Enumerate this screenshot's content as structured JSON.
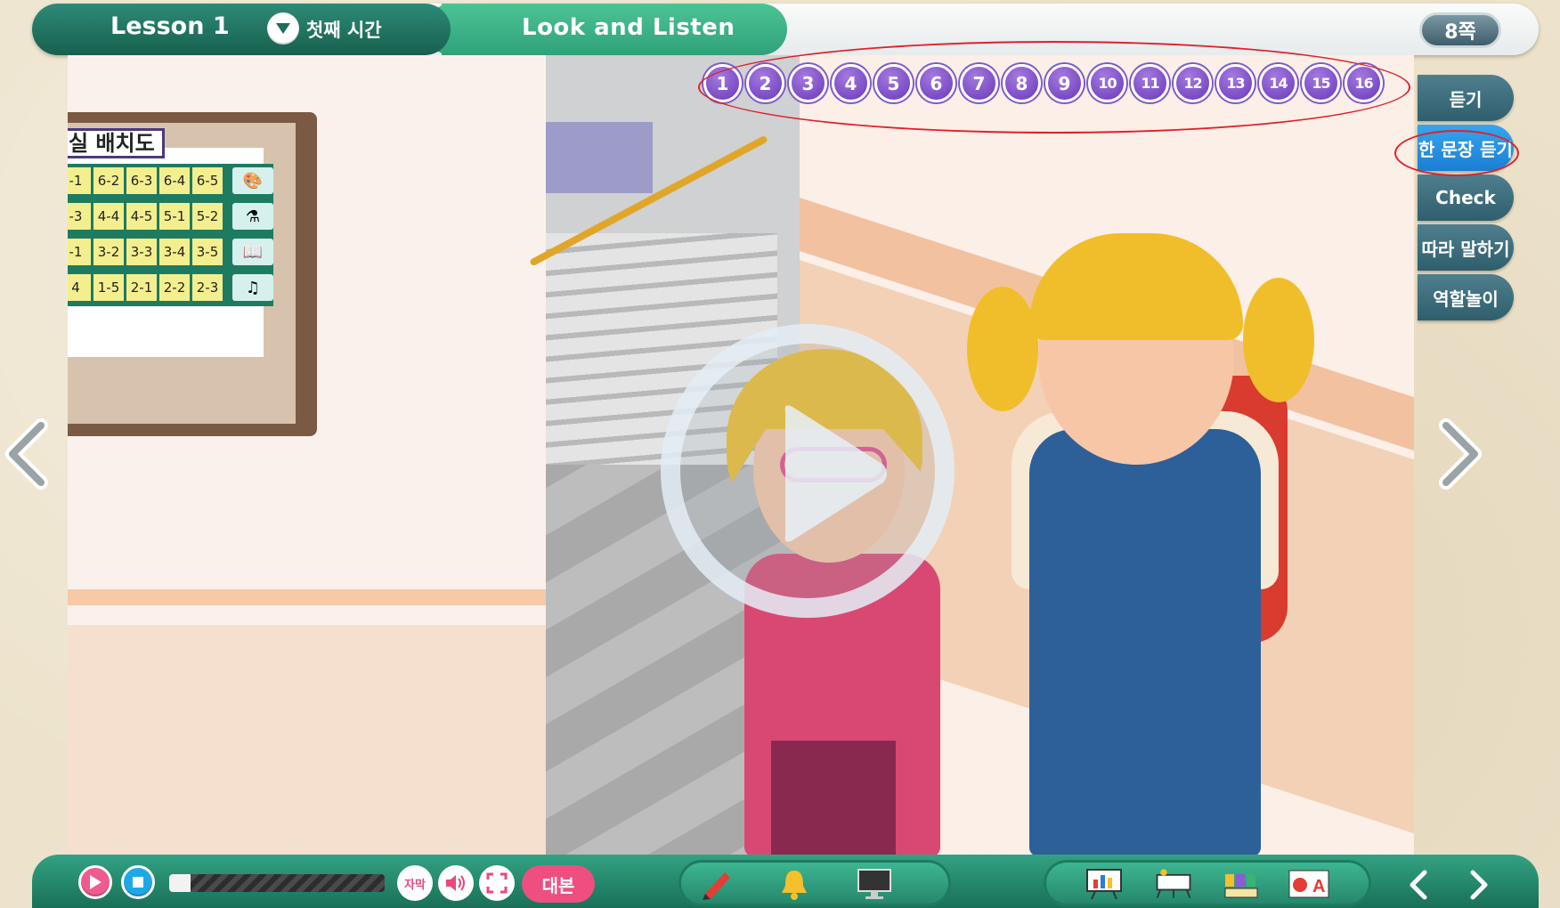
{
  "header": {
    "lesson_title": "Lesson 1",
    "period_label": "첫째 시간",
    "section_title": "Look and Listen",
    "page_label": "8쪽"
  },
  "board": {
    "title": "실 배치도",
    "rows": [
      {
        "cells": [
          "-1",
          "6-2",
          "6-3",
          "6-4",
          "6-5"
        ],
        "icon": "palette-icon"
      },
      {
        "cells": [
          "-3",
          "4-4",
          "4-5",
          "5-1",
          "5-2"
        ],
        "icon": "flask-icon"
      },
      {
        "cells": [
          "-1",
          "3-2",
          "3-3",
          "3-4",
          "3-5"
        ],
        "icon": "book-icon"
      },
      {
        "cells": [
          "4",
          "1-5",
          "2-1",
          "2-2",
          "2-3"
        ],
        "icon": "music-icon"
      }
    ]
  },
  "sentences": [
    "1",
    "2",
    "3",
    "4",
    "5",
    "6",
    "7",
    "8",
    "9",
    "10",
    "11",
    "12",
    "13",
    "14",
    "15",
    "16"
  ],
  "side_menu": [
    {
      "label": "듣기",
      "active": false
    },
    {
      "label": "한 문장 듣기",
      "active": true
    },
    {
      "label": "Check",
      "active": false
    },
    {
      "label": "따라 말하기",
      "active": false
    },
    {
      "label": "역할놀이",
      "active": false
    }
  ],
  "player": {
    "progress": 0.1,
    "subtitle_label": "자막",
    "script_label": "대본"
  },
  "colors": {
    "header_green": "#17604f",
    "section_green": "#2fa27b",
    "number_purple": "#6a38b9",
    "side_active": "#1a7fd4",
    "annotation_red": "#e0202a"
  }
}
